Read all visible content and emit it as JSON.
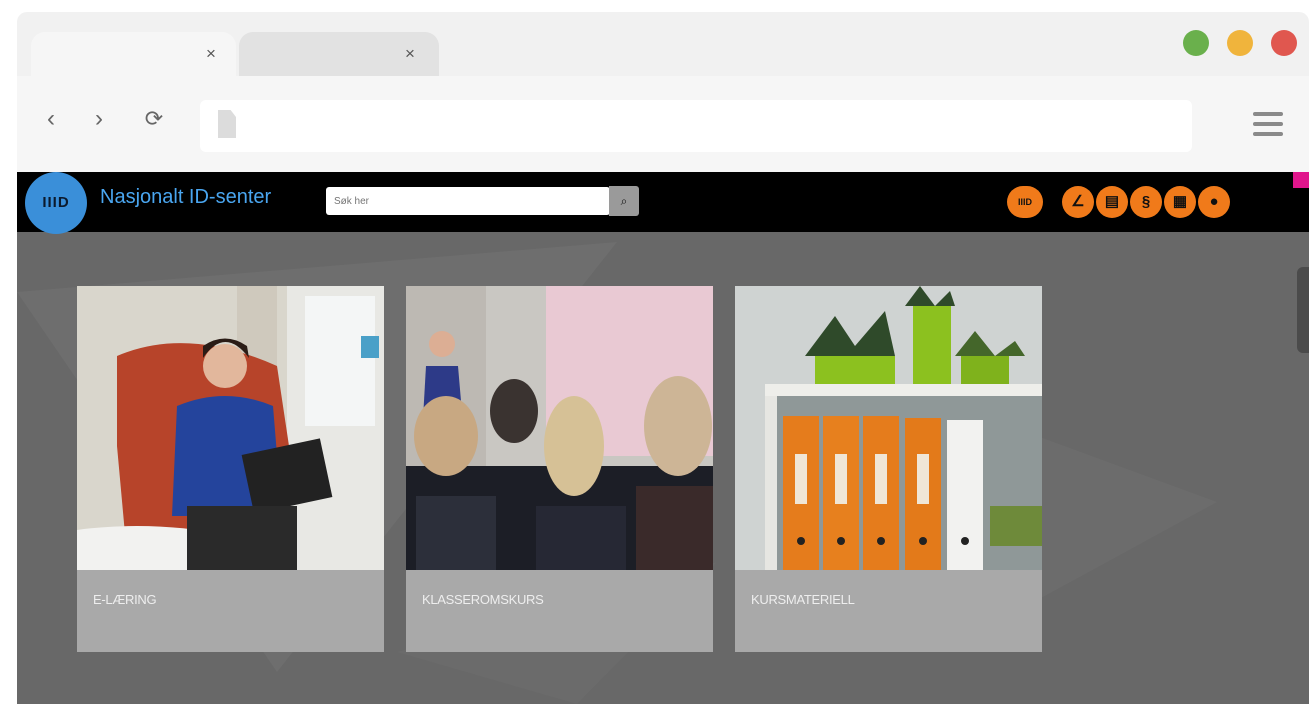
{
  "browser": {
    "tabs": [
      {
        "close_symbol": "×"
      },
      {
        "close_symbol": "×"
      }
    ],
    "window_controls": {
      "colors": [
        "#6ab04c",
        "#f0b43c",
        "#e0574f"
      ]
    },
    "nav": {
      "back": "‹",
      "forward": "›",
      "reload": "⟳"
    },
    "icons": [
      "file-icon",
      "hamburger-menu-icon"
    ]
  },
  "site": {
    "logo_text": "IIID",
    "title": "Nasjonalt ID-senter",
    "search": {
      "placeholder": "Søk her",
      "button_glyph": "⌕"
    },
    "toolbar_icons": [
      {
        "name": "iiid-icon",
        "glyph": "IIID"
      },
      {
        "name": "compass-icon",
        "glyph": "∠"
      },
      {
        "name": "documents-icon",
        "glyph": "▤"
      },
      {
        "name": "paragraph-icon",
        "glyph": "§"
      },
      {
        "name": "calendar-icon",
        "glyph": "▦"
      },
      {
        "name": "user-icon",
        "glyph": "●"
      }
    ],
    "accent_color": "#f07a1a"
  },
  "cards": [
    {
      "label": "E-LÆRING"
    },
    {
      "label": "KLASSEROMSKURS"
    },
    {
      "label": "KURSMATERIELL"
    }
  ]
}
